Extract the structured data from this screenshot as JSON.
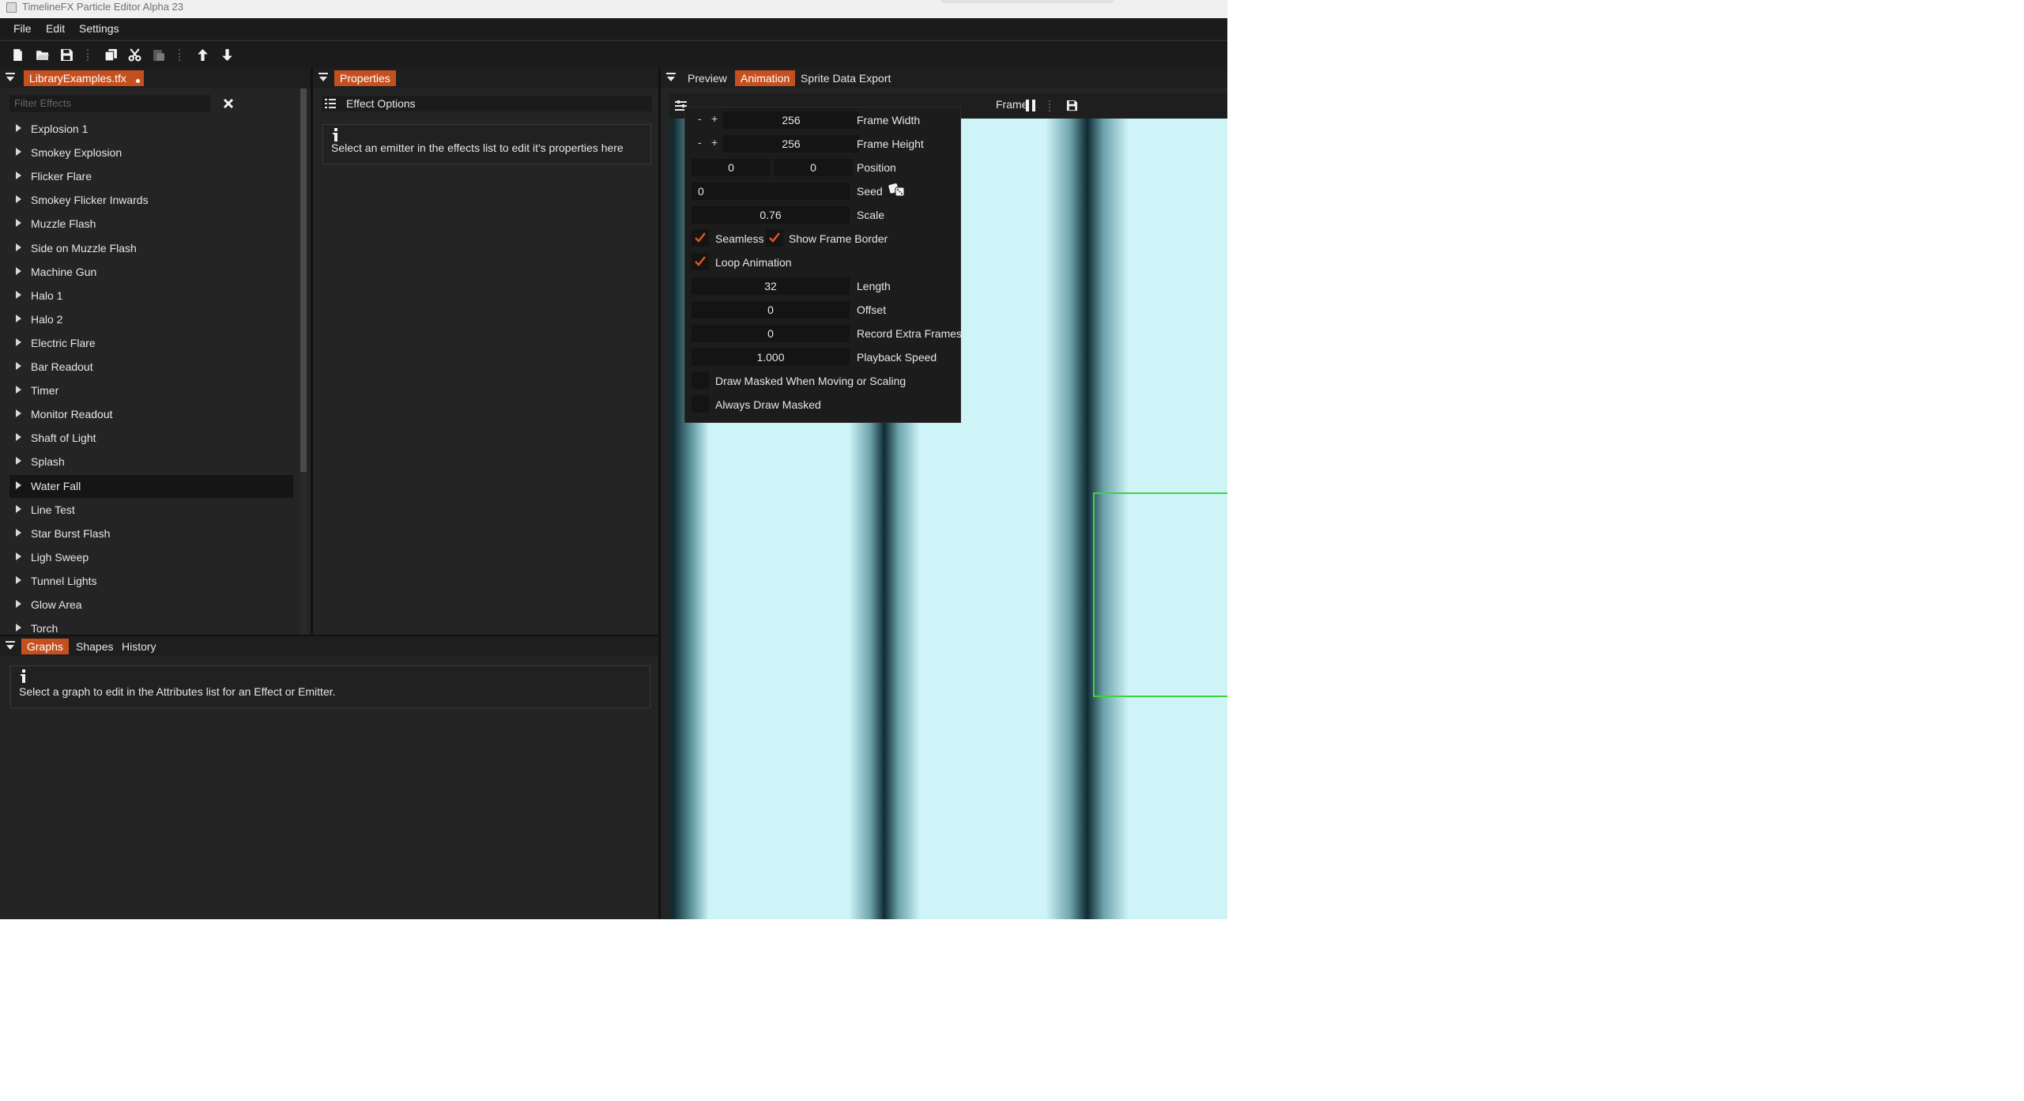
{
  "window": {
    "title": "TimelineFX Particle Editor Alpha 23"
  },
  "menu": {
    "items": [
      "File",
      "Edit",
      "Settings"
    ]
  },
  "toolbar": {
    "buttons": [
      "new-file-icon",
      "open-folder-icon",
      "save-icon",
      "copy-icon",
      "cut-icon",
      "paste-icon",
      "move-up-icon",
      "move-down-icon"
    ]
  },
  "library": {
    "tab_label": "LibraryExamples.tfx",
    "filter_placeholder": "Filter Effects",
    "selected": "Water Fall",
    "effects": [
      "Explosion 1",
      "Smokey Explosion",
      "Flicker Flare",
      "Smokey Flicker Inwards",
      "Muzzle Flash",
      "Side on Muzzle Flash",
      "Machine Gun",
      "Halo 1",
      "Halo 2",
      "Electric Flare",
      "Bar Readout",
      "Timer",
      "Monitor Readout",
      "Shaft of Light",
      "Splash",
      "Water Fall",
      "Line Test",
      "Star Burst Flash",
      "Ligh Sweep",
      "Tunnel Lights",
      "Glow Area",
      "Torch"
    ]
  },
  "properties": {
    "tab_label": "Properties",
    "section_title": "Effect Options",
    "message": "Select an emitter in the effects list to edit it's properties here"
  },
  "bottom": {
    "tabs": [
      "Graphs",
      "Shapes",
      "History"
    ],
    "active_tab": "Graphs",
    "message": "Select a graph to edit in the Attributes list for an Effect or Emitter."
  },
  "preview": {
    "tabs": [
      "Preview",
      "Animation",
      "Sprite Data Export"
    ],
    "active_tab": "Animation",
    "frame_label": "Frame",
    "colors": {
      "accent": "#c5501f",
      "preview_background": "#cef4f8",
      "dark_stripe": "#0f2a33",
      "frame_border": "#3fd23f"
    }
  },
  "animation_popup": {
    "frame_width": {
      "value": "256",
      "label": "Frame Width"
    },
    "frame_height": {
      "value": "256",
      "label": "Frame Height"
    },
    "position": {
      "x": "0",
      "y": "0",
      "label": "Position"
    },
    "seed": {
      "value": "0",
      "label": "Seed"
    },
    "scale": {
      "value": "0.76",
      "label": "Scale"
    },
    "seamless": {
      "label": "Seamless",
      "checked": true
    },
    "show_frame_border": {
      "label": "Show Frame Border",
      "checked": true
    },
    "loop_animation": {
      "label": "Loop Animation",
      "checked": true
    },
    "length": {
      "value": "32",
      "label": "Length"
    },
    "offset": {
      "value": "0",
      "label": "Offset"
    },
    "record_extra_frames": {
      "value": "0",
      "label": "Record Extra Frames"
    },
    "playback_speed": {
      "value": "1.000",
      "label": "Playback Speed"
    },
    "draw_masked_moving": {
      "label": "Draw Masked When Moving or Scaling",
      "checked": false
    },
    "always_draw_masked": {
      "label": "Always Draw Masked",
      "checked": false
    },
    "minus": "-",
    "plus": "+"
  }
}
